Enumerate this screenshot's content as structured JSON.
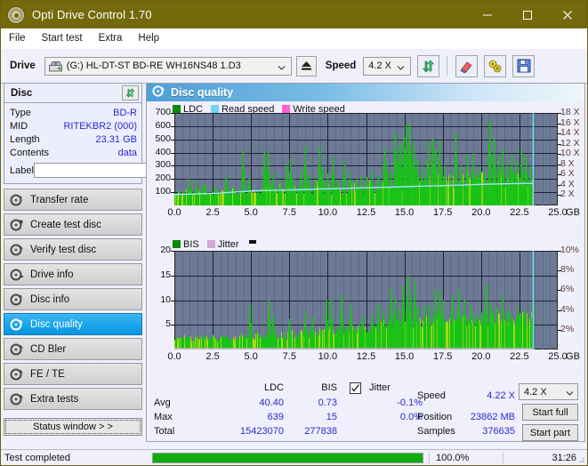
{
  "window": {
    "title": "Opti Drive Control 1.70",
    "icon": "disc-icon",
    "minimize": "minimize-icon",
    "maximize": "maximize-icon",
    "close": "close-icon",
    "titlebar_color": "#756a0b"
  },
  "menubar": {
    "items": [
      "File",
      "Start test",
      "Extra",
      "Help"
    ]
  },
  "toolbar": {
    "drive_label": "Drive",
    "drive_value": "(G:)  HL-DT-ST BD-RE  WH16NS48 1.D3",
    "eject_icon": "eject-icon",
    "speed_label": "Speed",
    "speed_value": "4.2 X",
    "refresh_icon": "refresh-icon",
    "erase_icon": "eraser-icon",
    "settings_icon": "tools-icon",
    "save_icon": "save-icon"
  },
  "disc_panel": {
    "title": "Disc",
    "refresh_icon": "refresh-icon",
    "rows": [
      {
        "key": "Type",
        "value": "BD-R"
      },
      {
        "key": "MID",
        "value": "RITEKBR2 (000)"
      },
      {
        "key": "Length",
        "value": "23.31 GB"
      },
      {
        "key": "Contents",
        "value": "data"
      }
    ],
    "label_key": "Label",
    "label_value": "",
    "label_placeholder": "",
    "label_button_icon": "disc-icon"
  },
  "sidebar": {
    "items": [
      {
        "label": "Transfer rate",
        "icon": "disc-test-icon",
        "active": false
      },
      {
        "label": "Create test disc",
        "icon": "disc-burn-icon",
        "active": false
      },
      {
        "label": "Verify test disc",
        "icon": "disc-verify-icon",
        "active": false
      },
      {
        "label": "Drive info",
        "icon": "drive-info-icon",
        "active": false
      },
      {
        "label": "Disc info",
        "icon": "disc-info-icon",
        "active": false
      },
      {
        "label": "Disc quality",
        "icon": "disc-quality-icon",
        "active": true
      },
      {
        "label": "CD Bler",
        "icon": "disc-bler-icon",
        "active": false
      },
      {
        "label": "FE / TE",
        "icon": "disc-fete-icon",
        "active": false
      },
      {
        "label": "Extra tests",
        "icon": "disc-extra-icon",
        "active": false
      }
    ],
    "status_window": "Status window > >"
  },
  "main": {
    "header_title": "Disc quality",
    "header_icon": "disc-quality-icon"
  },
  "chart_data": [
    {
      "type": "area",
      "title": "Disc quality - LDC",
      "legend": [
        {
          "label": "LDC",
          "color": "#0a8a0a"
        },
        {
          "label": "Read speed",
          "color": "#74d2f5"
        },
        {
          "label": "Write speed",
          "color": "#ff5fd0"
        }
      ],
      "legend_position": "top-left",
      "xlabel": "GB",
      "ylabel": "LDC",
      "y2label": "X",
      "xlim": [
        0,
        25.0
      ],
      "ylim": [
        0,
        700
      ],
      "y2lim": [
        0,
        18
      ],
      "grid": true,
      "xticks": [
        "0.0",
        "2.5",
        "5.0",
        "7.5",
        "10.0",
        "12.5",
        "15.0",
        "17.5",
        "20.0",
        "22.5",
        "25.0"
      ],
      "yticks": [
        100,
        200,
        300,
        400,
        500,
        600,
        700
      ],
      "y2ticks": [
        "2 X",
        "4 X",
        "6 X",
        "8 X",
        "10 X",
        "12 X",
        "14 X",
        "16 X",
        "18 X"
      ],
      "data_end_gb": 23.4,
      "ldc_baseline": [
        60,
        70,
        62,
        75,
        90,
        70,
        64,
        85,
        120,
        70,
        66,
        78,
        62,
        90,
        72,
        66,
        88,
        70,
        62,
        74,
        68,
        92,
        78,
        66,
        84,
        70,
        110,
        76,
        66,
        88,
        70,
        64,
        80,
        96,
        72,
        66,
        84,
        70,
        66,
        92,
        78,
        70,
        86,
        74,
        68,
        90,
        76,
        70,
        84,
        96,
        72,
        88,
        78,
        70,
        92,
        80,
        74,
        96,
        86,
        78,
        100,
        88,
        80,
        104,
        92,
        84,
        108,
        96,
        88,
        112,
        100,
        92,
        116,
        104,
        96,
        120,
        108,
        100,
        124,
        112,
        104,
        128,
        116,
        108,
        132,
        120,
        112,
        136,
        124,
        116,
        140,
        128,
        120,
        144,
        132,
        124,
        148,
        136,
        128,
        152
      ],
      "ldc_spikes": [
        {
          "gb": 0.9,
          "v": 200
        },
        {
          "gb": 1.45,
          "v": 185
        },
        {
          "gb": 2.0,
          "v": 155
        },
        {
          "gb": 2.6,
          "v": 150
        },
        {
          "gb": 3.35,
          "v": 230
        },
        {
          "gb": 3.45,
          "v": 175
        },
        {
          "gb": 4.45,
          "v": 415
        },
        {
          "gb": 4.9,
          "v": 210
        },
        {
          "gb": 5.85,
          "v": 410
        },
        {
          "gb": 6.1,
          "v": 400
        },
        {
          "gb": 6.45,
          "v": 235
        },
        {
          "gb": 6.9,
          "v": 190
        },
        {
          "gb": 7.3,
          "v": 300
        },
        {
          "gb": 7.55,
          "v": 350
        },
        {
          "gb": 7.8,
          "v": 200
        },
        {
          "gb": 8.25,
          "v": 260
        },
        {
          "gb": 8.55,
          "v": 450
        },
        {
          "gb": 8.75,
          "v": 225
        },
        {
          "gb": 9.1,
          "v": 195
        },
        {
          "gb": 9.45,
          "v": 450
        },
        {
          "gb": 9.6,
          "v": 300
        },
        {
          "gb": 9.95,
          "v": 240
        },
        {
          "gb": 10.3,
          "v": 370
        },
        {
          "gb": 10.6,
          "v": 195
        },
        {
          "gb": 11.05,
          "v": 335
        },
        {
          "gb": 11.4,
          "v": 250
        },
        {
          "gb": 11.9,
          "v": 200
        },
        {
          "gb": 12.2,
          "v": 230
        },
        {
          "gb": 12.5,
          "v": 215
        },
        {
          "gb": 12.9,
          "v": 260
        },
        {
          "gb": 13.3,
          "v": 230
        },
        {
          "gb": 13.7,
          "v": 440
        },
        {
          "gb": 13.85,
          "v": 330
        },
        {
          "gb": 14.1,
          "v": 250
        },
        {
          "gb": 14.4,
          "v": 560
        },
        {
          "gb": 14.55,
          "v": 430
        },
        {
          "gb": 14.75,
          "v": 470
        },
        {
          "gb": 14.95,
          "v": 520
        },
        {
          "gb": 15.1,
          "v": 605
        },
        {
          "gb": 15.3,
          "v": 635
        },
        {
          "gb": 15.45,
          "v": 410
        },
        {
          "gb": 15.6,
          "v": 480
        },
        {
          "gb": 15.85,
          "v": 350
        },
        {
          "gb": 16.1,
          "v": 300
        },
        {
          "gb": 16.55,
          "v": 480
        },
        {
          "gb": 16.8,
          "v": 500
        },
        {
          "gb": 17.0,
          "v": 430
        },
        {
          "gb": 17.3,
          "v": 490
        },
        {
          "gb": 17.55,
          "v": 300
        },
        {
          "gb": 18.0,
          "v": 250
        },
        {
          "gb": 18.35,
          "v": 545
        },
        {
          "gb": 18.7,
          "v": 300
        },
        {
          "gb": 19.1,
          "v": 380
        },
        {
          "gb": 19.5,
          "v": 400
        },
        {
          "gb": 19.9,
          "v": 290
        },
        {
          "gb": 20.2,
          "v": 240
        },
        {
          "gb": 20.55,
          "v": 640
        },
        {
          "gb": 20.8,
          "v": 510
        },
        {
          "gb": 21.1,
          "v": 380
        },
        {
          "gb": 21.4,
          "v": 430
        },
        {
          "gb": 21.7,
          "v": 300
        },
        {
          "gb": 22.0,
          "v": 390
        },
        {
          "gb": 22.3,
          "v": 330
        },
        {
          "gb": 22.6,
          "v": 430
        },
        {
          "gb": 22.9,
          "v": 380
        },
        {
          "gb": 23.2,
          "v": 300
        }
      ],
      "read_speed_curve": [
        {
          "gb": 0.0,
          "x": 2.1
        },
        {
          "gb": 1.0,
          "x": 2.2
        },
        {
          "gb": 2.5,
          "x": 2.35
        },
        {
          "gb": 4.0,
          "x": 2.6
        },
        {
          "gb": 5.2,
          "x": 2.85
        },
        {
          "gb": 6.5,
          "x": 2.95
        },
        {
          "gb": 8.0,
          "x": 3.05
        },
        {
          "gb": 9.5,
          "x": 3.2
        },
        {
          "gb": 11.0,
          "x": 3.3
        },
        {
          "gb": 12.5,
          "x": 3.45
        },
        {
          "gb": 14.0,
          "x": 3.55
        },
        {
          "gb": 15.5,
          "x": 3.7
        },
        {
          "gb": 17.0,
          "x": 3.8
        },
        {
          "gb": 18.5,
          "x": 3.95
        },
        {
          "gb": 20.0,
          "x": 4.1
        },
        {
          "gb": 21.5,
          "x": 4.2
        },
        {
          "gb": 23.0,
          "x": 4.3
        },
        {
          "gb": 23.4,
          "x": 4.3
        }
      ],
      "cursor_gb": 23.4,
      "cursor_color": "#74d2f5"
    },
    {
      "type": "area",
      "title": "Disc quality - BIS / Jitter",
      "legend": [
        {
          "label": "BIS",
          "color": "#0a8a0a"
        },
        {
          "label": "Jitter",
          "color": "#d0a8d8"
        }
      ],
      "legend_position": "top-left",
      "xlabel": "GB",
      "ylabel": "BIS",
      "y2label": "%",
      "xlim": [
        0,
        25.0
      ],
      "ylim": [
        0,
        20
      ],
      "y2lim": [
        0,
        10
      ],
      "grid": true,
      "xticks": [
        "0.0",
        "2.5",
        "5.0",
        "7.5",
        "10.0",
        "12.5",
        "15.0",
        "17.5",
        "20.0",
        "22.5",
        "25.0"
      ],
      "yticks": [
        5,
        10,
        15,
        20
      ],
      "y2ticks": [
        "2%",
        "4%",
        "6%",
        "8%",
        "10%"
      ],
      "data_end_gb": 23.4,
      "bis_baseline": [
        1.6,
        1.8,
        1.5,
        2.0,
        1.7,
        1.6,
        2.1,
        1.8,
        1.6,
        2.0,
        1.7,
        1.9,
        1.6,
        2.2,
        1.8,
        1.6,
        2.0,
        1.7,
        1.9,
        2.1,
        1.8,
        2.0,
        1.7,
        2.2,
        1.9,
        1.8,
        2.1,
        2.3,
        1.9,
        2.0,
        2.2,
        1.8,
        2.4,
        2.0,
        2.2,
        2.5,
        2.1,
        2.3,
        2.6,
        2.2,
        2.8,
        2.4,
        2.6,
        3.0,
        2.5,
        2.8,
        3.2,
        2.7,
        3.0,
        3.4,
        2.9,
        3.2,
        3.6,
        3.1,
        3.4,
        3.8,
        3.3,
        3.6,
        4.0,
        3.5,
        3.8,
        4.2,
        3.7,
        4.0,
        4.4,
        3.9,
        4.2,
        4.6,
        4.1,
        4.4,
        4.8,
        4.3,
        4.6,
        4.9,
        4.4,
        4.7,
        5.0,
        4.5,
        4.8,
        5.0,
        4.6,
        4.9,
        5.0,
        4.7,
        4.9,
        5.0,
        4.6,
        4.8,
        5.0,
        4.7,
        4.9,
        4.8,
        4.6,
        4.9,
        4.7,
        4.8,
        4.9,
        4.7,
        4.8,
        4.9
      ],
      "bis_spikes": [
        {
          "gb": 4.95,
          "v": 9.0
        },
        {
          "gb": 6.15,
          "v": 10.0
        },
        {
          "gb": 6.45,
          "v": 7.0
        },
        {
          "gb": 7.5,
          "v": 6.2
        },
        {
          "gb": 8.5,
          "v": 7.5
        },
        {
          "gb": 9.0,
          "v": 6.5
        },
        {
          "gb": 9.9,
          "v": 10.0
        },
        {
          "gb": 10.2,
          "v": 10.1
        },
        {
          "gb": 10.9,
          "v": 11.2
        },
        {
          "gb": 11.5,
          "v": 9.0
        },
        {
          "gb": 12.3,
          "v": 6.8
        },
        {
          "gb": 12.9,
          "v": 7.3
        },
        {
          "gb": 13.3,
          "v": 9.2
        },
        {
          "gb": 13.6,
          "v": 7.8
        },
        {
          "gb": 14.1,
          "v": 12.2
        },
        {
          "gb": 14.4,
          "v": 10.2
        },
        {
          "gb": 14.6,
          "v": 8.5
        },
        {
          "gb": 14.9,
          "v": 13.2
        },
        {
          "gb": 15.2,
          "v": 15.1
        },
        {
          "gb": 15.4,
          "v": 11.0
        },
        {
          "gb": 15.65,
          "v": 14.1
        },
        {
          "gb": 15.9,
          "v": 8.6
        },
        {
          "gb": 16.3,
          "v": 8.8
        },
        {
          "gb": 16.6,
          "v": 9.0
        },
        {
          "gb": 17.0,
          "v": 12.1
        },
        {
          "gb": 17.3,
          "v": 12.0
        },
        {
          "gb": 17.5,
          "v": 10.0
        },
        {
          "gb": 18.1,
          "v": 11.0
        },
        {
          "gb": 18.5,
          "v": 12.2
        },
        {
          "gb": 18.9,
          "v": 10.0
        },
        {
          "gb": 19.3,
          "v": 9.0
        },
        {
          "gb": 20.3,
          "v": 13.1
        },
        {
          "gb": 20.6,
          "v": 9.5
        },
        {
          "gb": 21.0,
          "v": 8.5
        },
        {
          "gb": 21.4,
          "v": 11.0
        },
        {
          "gb": 21.7,
          "v": 8.0
        },
        {
          "gb": 22.4,
          "v": 8.6
        },
        {
          "gb": 23.3,
          "v": 9.1
        }
      ],
      "jitter_level": 0.0,
      "cursor_gb": 23.4,
      "cursor_color": "#74d2f5"
    }
  ],
  "stats": {
    "col_headers": [
      "LDC",
      "BIS"
    ],
    "rows": [
      {
        "name": "Avg",
        "ldc": "40.40",
        "bis": "0.73",
        "jitter": "-0.1%"
      },
      {
        "name": "Max",
        "ldc": "639",
        "bis": "15",
        "jitter": "0.0%"
      },
      {
        "name": "Total",
        "ldc": "15423070",
        "bis": "277838",
        "jitter": ""
      }
    ],
    "jitter_label": "Jitter",
    "jitter_checked": true,
    "speed_label": "Speed",
    "speed_value": "4.22 X",
    "position_label": "Position",
    "position_value": "23862 MB",
    "samples_label": "Samples",
    "samples_value": "376635",
    "speed_select": "4.2 X",
    "start_full": "Start full",
    "start_part": "Start part"
  },
  "statusbar": {
    "text": "Test completed",
    "progress": 100,
    "percent": "100.0%",
    "time": "31:26",
    "bar_color": "#10ac10"
  }
}
